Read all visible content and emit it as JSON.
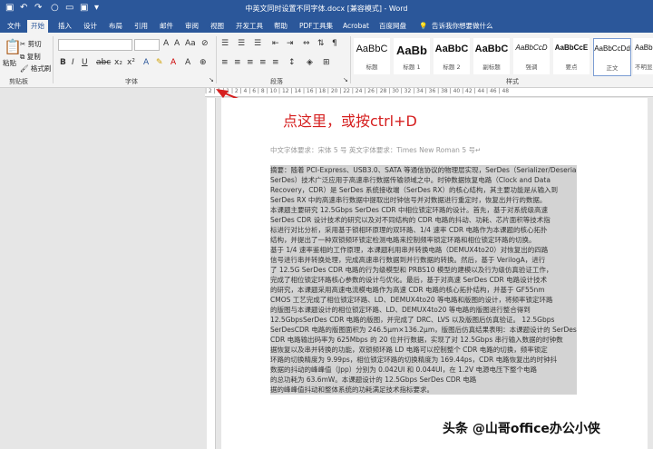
{
  "window": {
    "title": "中英文同时设置不同字体.docx [兼容模式] - Word"
  },
  "tabs": [
    "文件",
    "开始",
    "插入",
    "设计",
    "布局",
    "引用",
    "邮件",
    "审阅",
    "视图",
    "开发工具",
    "帮助",
    "PDF工具集",
    "Acrobat",
    "百度网盘"
  ],
  "tell_me": "告诉我你想要做什么",
  "clipboard": {
    "paste": "粘贴",
    "cut": "剪切",
    "copy": "复制",
    "format_painter": "格式刷",
    "group_label": "剪贴板"
  },
  "font_group": {
    "label": "字体",
    "font_name": "",
    "font_size": ""
  },
  "paragraph_group": {
    "label": "段落"
  },
  "styles_group": {
    "label": "样式"
  },
  "styles": [
    {
      "sample": "AaBbC",
      "name": "标题"
    },
    {
      "sample": "AaBb",
      "name": "标题 1"
    },
    {
      "sample": "AaBbC",
      "name": "标题 2"
    },
    {
      "sample": "AaBbC",
      "name": "副标题"
    },
    {
      "sample": "AaBbCcD",
      "name": "强调"
    },
    {
      "sample": "AaBbCcE",
      "name": "要点"
    },
    {
      "sample": "AaBbCcDd",
      "name": "正文"
    },
    {
      "sample": "AaBbC",
      "name": "不明显"
    }
  ],
  "ruler_text": "| 2 | 1 | 1 | 2 | 4 | 6 | 8 | 10 | 12 | 14 | 16 | 18 | 20 | 22 | 24 | 26 | 28 | 30 | 32 | 34 | 36 | 38 | 40 | 42 | 44 | 46 | 48",
  "callout": "点这里，或按ctrl+D",
  "requirement": "中文字体要求：宋体 5 号    英文字体要求：Times New Roman  5 号↵",
  "body_lines": [
    "摘要：随着 PCI-Express、USB3.0、SATA 等通信协议的物理层实现，SerDes（Serializer/Deserializer，",
    "SerDes）技术广泛应用于高速串行数据传输领域之中。时钟数据恢复电路（Clock and Data",
    "Recovery，CDR）是 SerDes 系统接收端（SerDes RX）的核心结构，其主要功能是从输入到",
    "SerDes RX 中的高速串行数据中提取出时钟信号并对数据进行重定时，恢复出并行的数据。",
    "本课题主要研究 12.5Gbps SerDes CDR 中相位锁定环路的设计。首先，基于对系统级高速",
    "SerDes CDR 设计技术的研究以及对不同结构的 CDR 电路的抖动、功耗、芯片面积等技术指",
    "标进行对比分析，采用基于锁相环原理的双环路、1/4 速率 CDR 电路作为本课题的核心拓扑",
    "结构，并提出了一种双锁频环锁定检测电路来控制频率锁定环路和相位锁定环路的切换。",
    "基于 1/4 速率鉴相的工作原理，本课题利用串并转换电路（DEMUX4to20）对恢复出的四路",
    "信号进行串并转换处理，完成高速串行数据到并行数据的转换。然后，基于 VerilogA，进行",
    "了 12.5G SerDes CDR 电路的行为级模型和 PRBS10 模型的建模以及行为级仿真验证工作，",
    "完成了相位锁定环路核心参数的设计与优化。最后，基于对高速 SerDes CDR 电路设计技术",
    "的研究，本课题采用高速电流模电路作为高速 CDR 电路的核心拓扑结构，并基于 GF55nm",
    "CMOS 工艺完成了相位锁定环路、LD、DEMUX4to20 等电路和版图的设计，将频率锁定环路",
    "的版图与本课题设计的相位锁定环路、LD、DEMUX4to20 等电路的版图进行整合得到",
    "12.5GbpsSerDes CDR 电路的版图，并完成了 DRC、LVS 以及版图后仿真验证。   12.5Gbps",
    "SerDesCDR 电路的版图面积为 246.5μm×136.2μm，版图后仿真结果表明：本课题设计的 SerDes",
    "CDR 电路输出码率为 625Mbps 的 20 位并行数据，实现了对 12.5Gbps 串行输入数据的时钟数",
    "据恢复以及串并转换的功能，双锁频环路 LD 电路可以控制整个 CDR 电路的切换，频率锁定",
    "环路的切换精度为 9.99ps，相位锁定环路的切换精度为 169.44ps，CDR 电路恢复出的时钟抖",
    "数据的抖动的峰峰值（Jpp）分别为 0.042UI 和 0.044UI，在 1.2V 电源电压下整个电路",
    "的总功耗为 63.6mW。本课题设计的 12.5Gbps SerDes CDR 电路",
    "据的峰峰值抖动和整体系统的功耗满足技术指标要求。"
  ],
  "watermark": "头条 @山哥office办公小侠"
}
